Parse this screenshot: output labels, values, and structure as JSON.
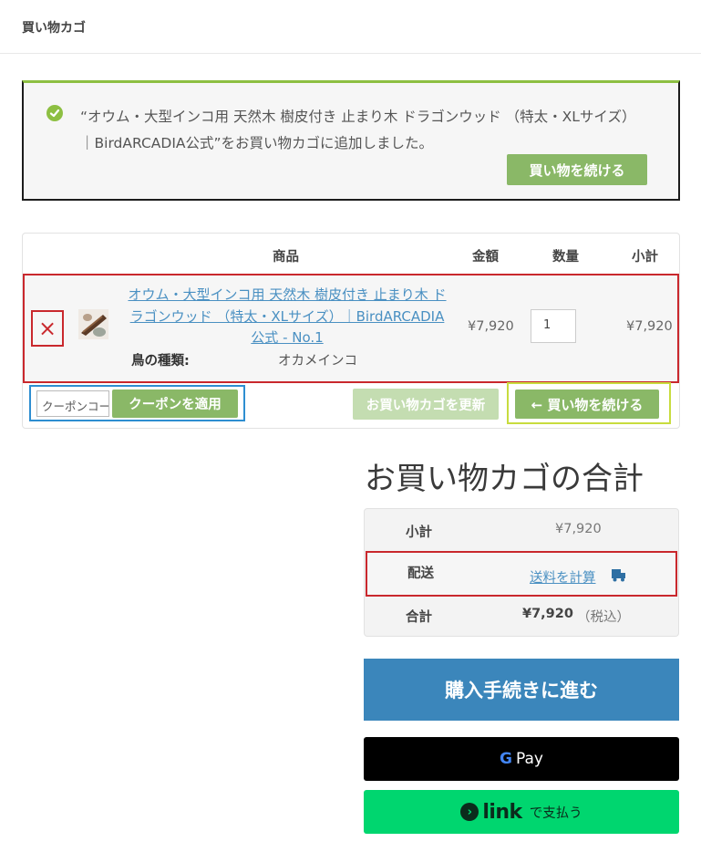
{
  "header": {
    "title": "買い物カゴ"
  },
  "notice": {
    "message": "“オウム・大型インコ用 天然木 樹皮付き 止まり木 ドラゴンウッド （特太・XLサイズ）｜BirdARCADIA公式”をお買い物カゴに追加しました。",
    "button": "買い物を続ける"
  },
  "cart": {
    "headers": {
      "product": "商品",
      "price": "金額",
      "quantity": "数量",
      "subtotal": "小計"
    },
    "item": {
      "remove_glyph": "×",
      "name": "オウム・大型インコ用 天然木 樹皮付き 止まり木 ドラゴンウッド （特太・XLサイズ）｜BirdARCADIA公式 - No.1",
      "meta_key": "鳥の種類:",
      "meta_value": "オカメインコ",
      "price": "¥7,920",
      "quantity": "1",
      "subtotal": "¥7,920"
    },
    "coupon_placeholder": "クーポンコード",
    "apply_coupon": "クーポンを適用",
    "update_cart": "お買い物カゴを更新",
    "continue_shopping": "← 買い物を続ける"
  },
  "totals": {
    "title": "お買い物カゴの合計",
    "subtotal_label": "小計",
    "subtotal_value": "¥7,920",
    "shipping_label": "配送",
    "shipping_link": "送料を計算",
    "total_label": "合計",
    "total_value": "¥7,920",
    "tax_note": "（税込）"
  },
  "payment": {
    "checkout": "購入手続きに進む",
    "gpay_g": "G",
    "gpay_label": "Pay",
    "link_glyph": "›",
    "link_word": "link",
    "link_suffix": "で支払う"
  },
  "colors": {
    "accent_green": "#8ab867",
    "checkout_blue": "#3b86bb",
    "link_green": "#00d66f",
    "highlight_red": "#c9282d"
  }
}
